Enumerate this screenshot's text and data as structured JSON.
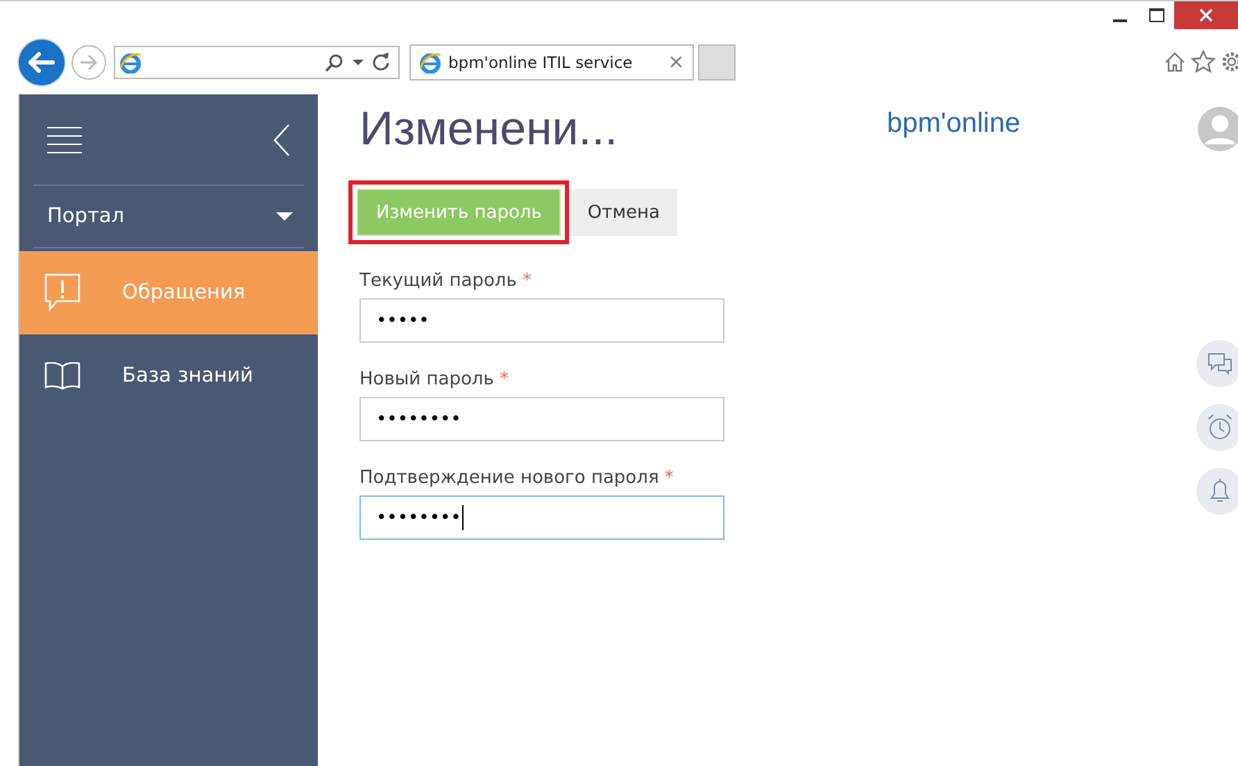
{
  "browser": {
    "tab_title": "bpm'online ITIL service",
    "tab_close": "×"
  },
  "sidebar": {
    "section": "Портал",
    "items": [
      {
        "label": "Обращения",
        "kind": "alert",
        "selected": true
      },
      {
        "label": "База знаний",
        "kind": "book",
        "selected": false
      }
    ]
  },
  "page": {
    "title": "Изменени...",
    "logo": "bpm'online"
  },
  "buttons": [
    {
      "label": "Изменить пароль",
      "kind": "primary",
      "highlighted": true
    },
    {
      "label": "Отмена",
      "kind": "secondary",
      "highlighted": false
    }
  ],
  "fields": [
    {
      "label": "Текущий пароль",
      "required_mark": "*",
      "value": "•••••",
      "focused": false
    },
    {
      "label": "Новый пароль",
      "required_mark": "*",
      "value": "••••••••",
      "focused": false
    },
    {
      "label": "Подтверждение нового пароля",
      "required_mark": "*",
      "value": "••••••••",
      "focused": true
    }
  ]
}
